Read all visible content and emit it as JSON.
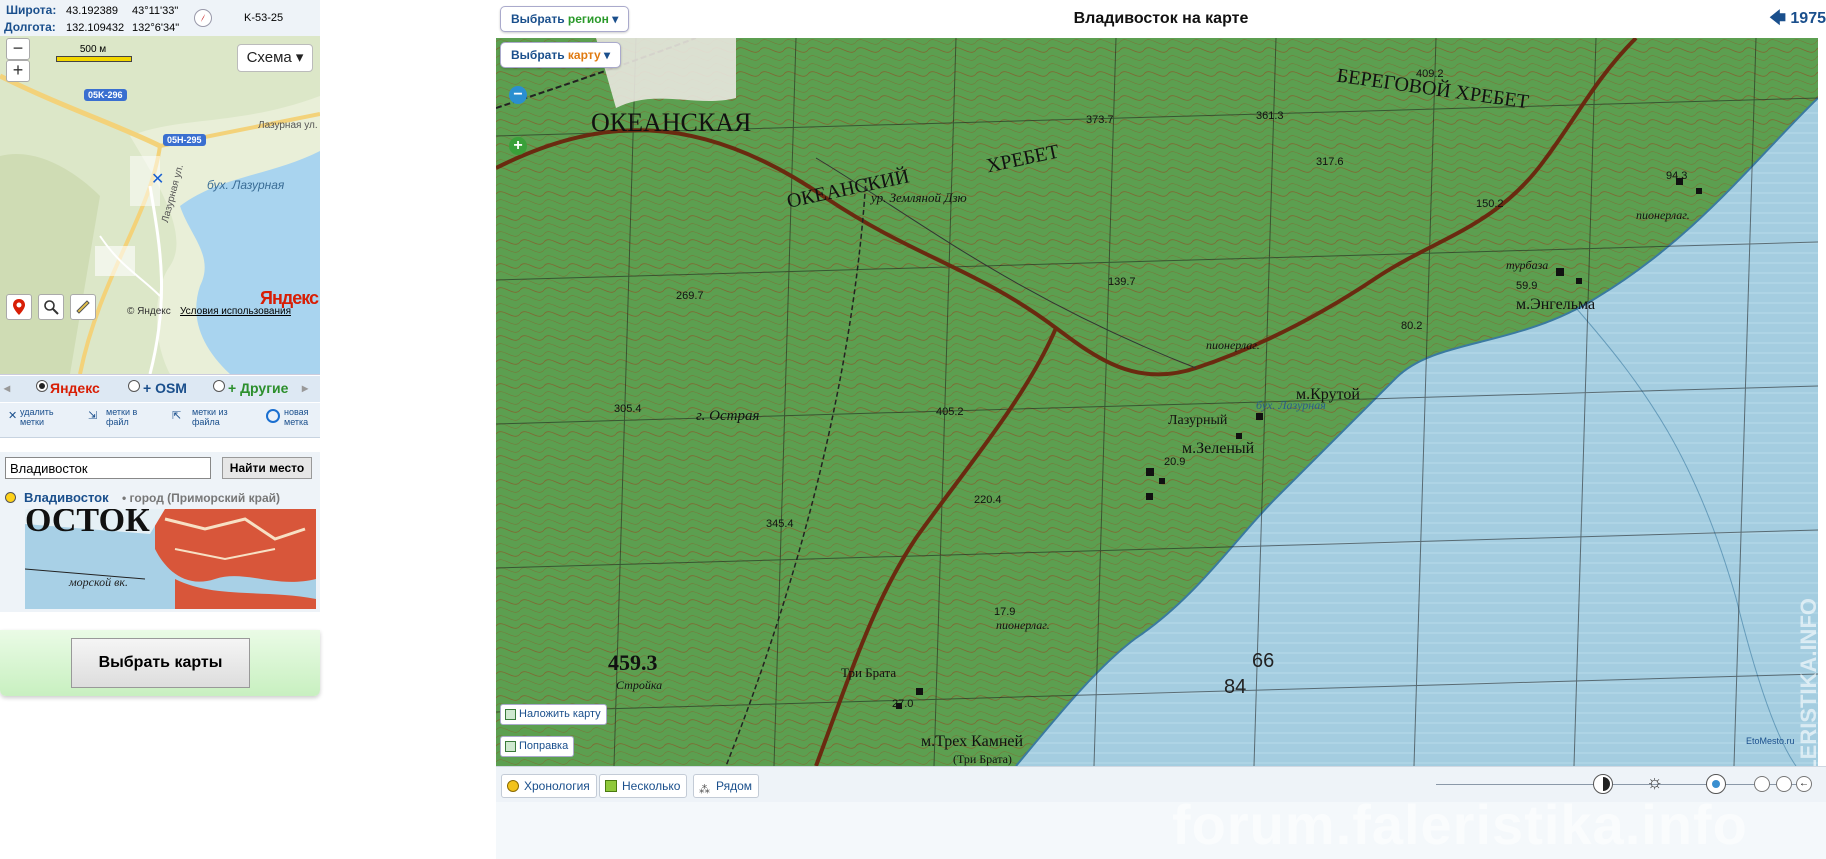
{
  "coords": {
    "lat_label": "Широта:",
    "lat_decimal": "43.192389",
    "lat_dms": "43°11'33\"",
    "lon_label": "Долгота:",
    "lon_decimal": "132.109432",
    "lon_dms": "132°6'34\"",
    "sheet": "K-53-25"
  },
  "minimap": {
    "scale": "500 м",
    "layer_button": "Схема",
    "road1": "05K-296",
    "road2": "05H-295",
    "street1": "Лазурная ул.",
    "street2": "Лазурная ул.",
    "bay": "бух. Лазурная",
    "provider_logo": "Яндекс",
    "copyright": "© Яндекс",
    "terms": "Условия использования"
  },
  "providers": [
    {
      "name": "Яндекс",
      "selected": true
    },
    {
      "name": "+ OSM",
      "selected": false
    },
    {
      "name": "+ Другие",
      "selected": false
    }
  ],
  "actions": [
    {
      "line1": "удалить",
      "line2": "метки"
    },
    {
      "line1": "метки в",
      "line2": "файл"
    },
    {
      "line1": "метки из",
      "line2": "файла"
    },
    {
      "line1": "новая",
      "line2": "метка"
    }
  ],
  "search": {
    "value": "Владивосток",
    "button": "Найти место",
    "result_name": "Владивосток",
    "result_desc": "• город (Приморский край)"
  },
  "choose_maps": "Выбрать карты",
  "header": {
    "region_pre": "Выбрать ",
    "region_word": "регион",
    "title": "Владивосток на карте",
    "year": "1975",
    "map_pre": "Выбрать ",
    "map_word": "карту"
  },
  "map_labels": {
    "okeanskaya": "ОКЕАНСКАЯ",
    "okeanskiy": "ОКЕАНСКИЙ",
    "khrebet": "ХРЕБЕТ",
    "beregovoy": "БЕРЕГОВОЙ ХРЕБЕТ",
    "zemlyanoy": "ур. Земляной Дзю",
    "ostraya": "г. Острая",
    "lazurny": "Лазурный",
    "zeleny": "м.Зеленый",
    "krutoy": "м.Крутой",
    "engelma": "м.Энгельма",
    "pionerlag1": "пионерлаг.",
    "pionerlag2": "пионерлаг.",
    "pionerlag3": "пионерлаг.",
    "turbaza": "турбаза",
    "bukhta": "бух. Лазурная",
    "trekh_kamney": "м.Трех Камней",
    "tri_brata": "(Три Брата)",
    "tri_brata2": "Три Брата",
    "stroyka": "Стройка",
    "h4593": "459.3",
    "h4092": "409.2",
    "h3737": "373.7",
    "h3613": "361.3",
    "h3176": "317.6",
    "h2697": "269.7",
    "h4052": "405.2",
    "h2204": "220.4",
    "h1397": "139.7",
    "h1502": "150.2",
    "h943": "94.3",
    "h599": "59.9",
    "h802": "80.2",
    "h209": "20.9",
    "h179": "17.9",
    "h270": "27.0",
    "h3454": "345.4",
    "h3054": "305.4",
    "n84": "84",
    "n66": "66"
  },
  "map_buttons": {
    "overlay": "Наложить карту",
    "correction": "Поправка"
  },
  "bottom": {
    "chronology": "Хронология",
    "several": "Несколько",
    "nearby": "Рядом"
  },
  "watermark": "forum.faleristika.info",
  "watermark_vertical": "FALERISTIKA.INFO",
  "map_credit": "EtoMesto.ru",
  "colors": {
    "forest": "#4f9a4a",
    "water": "#9fcbe0",
    "link": "#1a4f8c",
    "yandex_red": "#d81e05"
  }
}
